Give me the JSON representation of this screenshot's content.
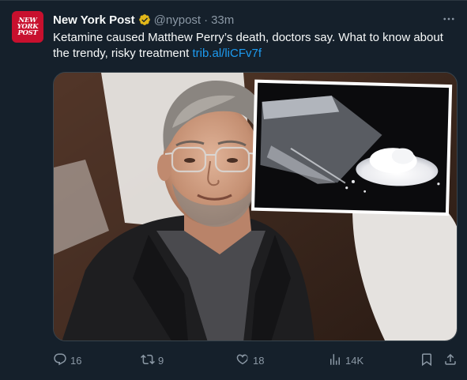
{
  "account": {
    "name": "New York Post",
    "handle": "@nypost",
    "separator": "·",
    "time": "33m",
    "avatar_lines": [
      "NEW",
      "YORK",
      "POST"
    ]
  },
  "post": {
    "text": "Ketamine caused Matthew Perry’s death, doctors say. What to know about the trendy, risky treatment ",
    "link": "trib.al/liCFv7f"
  },
  "actions": {
    "replies": "16",
    "reposts": "9",
    "likes": "18",
    "views": "14K"
  },
  "colors": {
    "background": "#15202b",
    "text": "#f7f9f9",
    "muted": "#8b98a5",
    "link": "#1d9bf0",
    "verified": "#e2b719",
    "brand": "#c8102e"
  },
  "icons": [
    "verified-badge-icon",
    "more-icon",
    "reply-icon",
    "retweet-icon",
    "like-icon",
    "views-icon",
    "bookmark-icon",
    "share-icon"
  ]
}
